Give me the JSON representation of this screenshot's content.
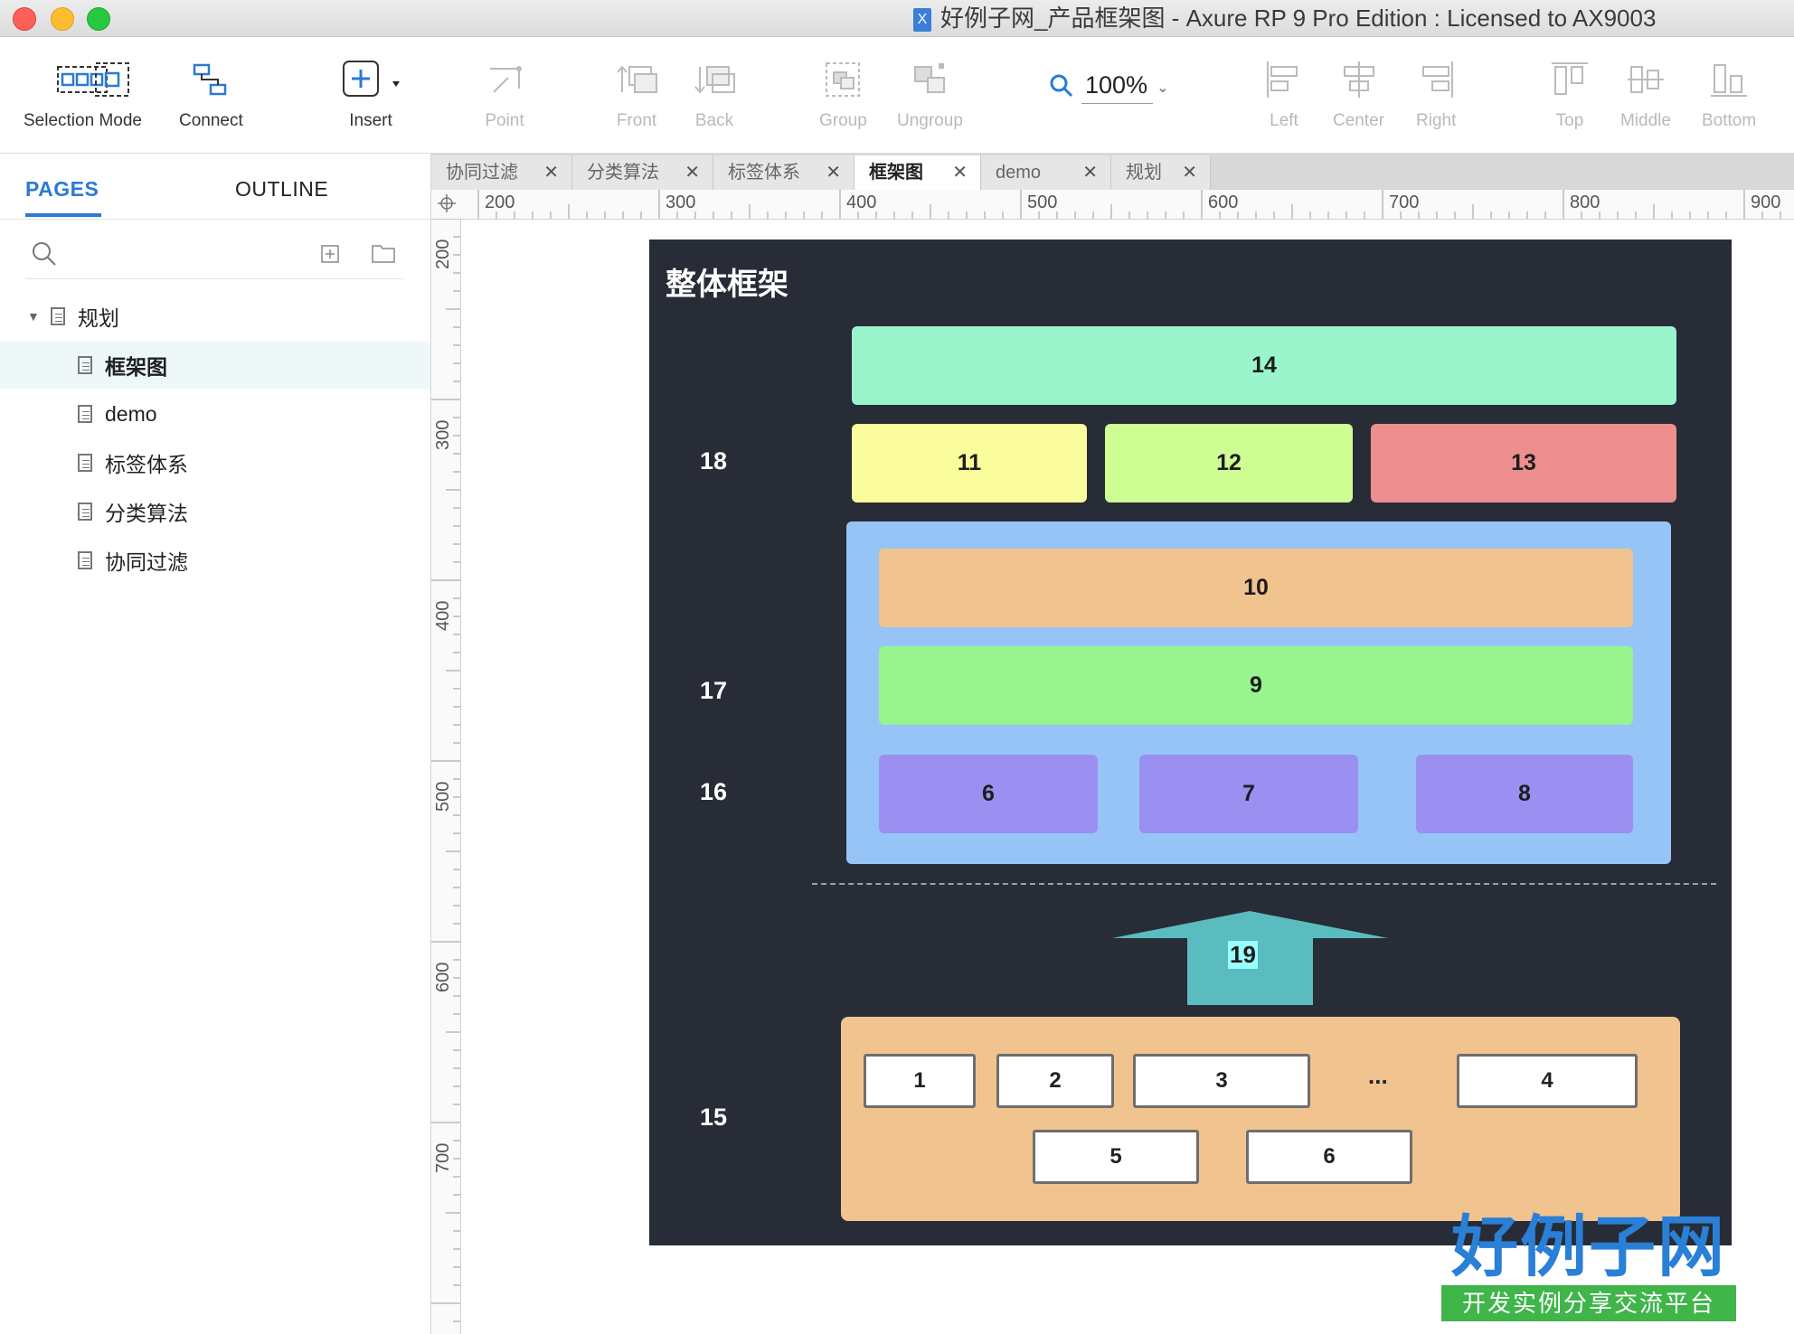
{
  "window": {
    "title": "好例子网_产品框架图 - Axure RP 9 Pro Edition : Licensed to AX9003",
    "doc_icon": "X"
  },
  "toolbar": {
    "selection_mode": "Selection Mode",
    "connect": "Connect",
    "insert": "Insert",
    "point": "Point",
    "front": "Front",
    "back": "Back",
    "group": "Group",
    "ungroup": "Ungroup",
    "zoom": "100%",
    "left": "Left",
    "center": "Center",
    "right": "Right",
    "top": "Top",
    "middle": "Middle",
    "bottom": "Bottom"
  },
  "panel": {
    "tab_pages": "PAGES",
    "tab_outline": "OUTLINE",
    "tree": [
      {
        "label": "规划"
      },
      {
        "label": "框架图"
      },
      {
        "label": "demo"
      },
      {
        "label": "标签体系"
      },
      {
        "label": "分类算法"
      },
      {
        "label": "协同过滤"
      }
    ]
  },
  "tabs": [
    {
      "label": "协同过滤"
    },
    {
      "label": "分类算法"
    },
    {
      "label": "标签体系"
    },
    {
      "label": "框架图"
    },
    {
      "label": "demo"
    },
    {
      "label": "规划"
    }
  ],
  "ruler": {
    "h": [
      "200",
      "300",
      "400",
      "500",
      "600",
      "700",
      "800",
      "900"
    ],
    "v": [
      "200",
      "300",
      "400",
      "500",
      "600",
      "700"
    ]
  },
  "diagram": {
    "title": "整体框架",
    "row_labels": {
      "r18": "18",
      "r17": "17",
      "r16": "16",
      "r15": "15"
    },
    "b14": "14",
    "b11": "11",
    "b12": "12",
    "b13": "13",
    "b10": "10",
    "b9": "9",
    "b6": "6",
    "b7": "7",
    "b8": "8",
    "arrow": "19",
    "w1": "1",
    "w2": "2",
    "w3": "3",
    "ellipsis": "...",
    "w4": "4",
    "w5": "5",
    "w6": "6",
    "colors": {
      "frame": "#272c37",
      "b14": "#9af5cd",
      "b11": "#fbfd9c",
      "b12": "#cdfd93",
      "b13": "#ee8f8f",
      "panel": "#97c4f7",
      "b10": "#f1c48f",
      "b9": "#97f48e",
      "purple": "#9b90f2",
      "arrow": "#5bbcbf",
      "base": "#f1c48f"
    }
  },
  "logo": {
    "main": "好例子网",
    "sub": "开发实例分享交流平台"
  }
}
